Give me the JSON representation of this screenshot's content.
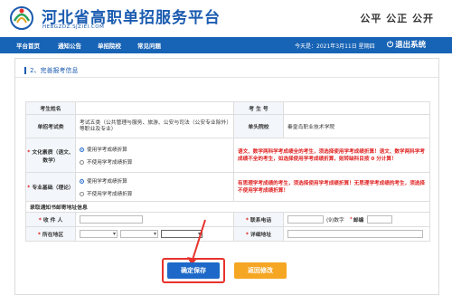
{
  "header": {
    "site_title": "河北省高职单招服务平台",
    "site_domain": "HEBGZDZ.SJZIEI.COM",
    "slogan": "公平 公正 公开"
  },
  "nav": {
    "items": [
      "平台首页",
      "通知公告",
      "单招院校",
      "常见问题"
    ],
    "date": "今天是：2021年3月11日 星期四",
    "logout_label": "退出系统"
  },
  "section": {
    "title": "2、完善报考信息"
  },
  "form": {
    "name_label": "考生姓名",
    "examno_label": "考 生 号",
    "category_label": "单招考试类",
    "category_value": "考试五类（公共管理与服务、旅游、公安与司法（公安专业除外）等职业及专业）",
    "school_label": "单头院校",
    "school_value": "秦皇岛职业技术学院",
    "culture_label": "文化素质（语文、数学）",
    "culture_opt1": "使用学考成绩折算",
    "culture_opt2": "不使用学考成绩折算",
    "culture_note": "语文、数学两科学考成绩全的考生，须选择使用学考成绩折算！语文、数学两科学考成绩不全的考生，如选择使用学考成绩折算，则转缺科目按 0 分计算！",
    "skill_label": "专业基础（理论）",
    "skill_opt1": "使用学考成绩折算",
    "skill_opt2": "不使用学考成绩折算",
    "skill_note": "有思理学考成绩的考生，须选择使用学考成绩折算！无思理学考成绩的考生，须选择不使用学考成绩折算！",
    "mail_title": "录取通知书邮寄地址信息",
    "receiver_label": "收 件 人",
    "phone_label": "联系电话",
    "phone_hint": "(9)数字",
    "postcode_label": "邮编",
    "region_label": "所在地区",
    "address_label": "详细地址"
  },
  "buttons": {
    "save": "确定保存",
    "back": "返回修改"
  },
  "colors": {
    "brand": "#1763b5",
    "save": "#1d68c8",
    "back": "#f5a623",
    "highlight": "#e8322c",
    "note": "#e02020"
  }
}
